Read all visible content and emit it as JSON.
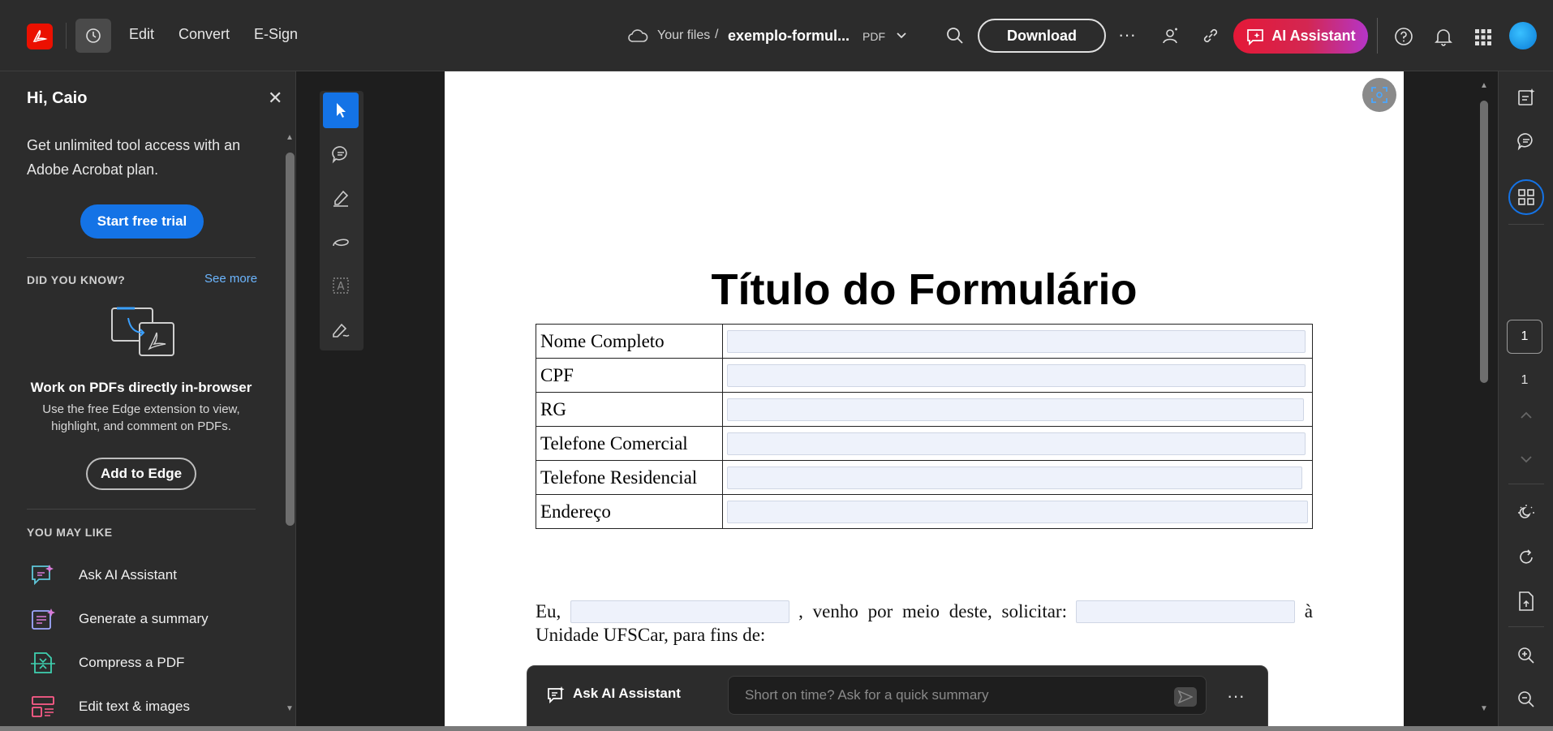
{
  "topbar": {
    "menus": [
      "Edit",
      "Convert",
      "E-Sign"
    ],
    "breadcrumb_root": "Your files",
    "breadcrumb_sep": "/",
    "filename": "exemplo-formul...",
    "file_type": "PDF",
    "download_label": "Download",
    "ai_assistant_label": "AI Assistant"
  },
  "left_panel": {
    "greeting": "Hi, Caio",
    "promo_text": "Get unlimited tool access with an Adobe Acrobat plan.",
    "trial_button": "Start free trial",
    "did_you_know_heading": "DID YOU KNOW?",
    "see_more": "See more",
    "tip_title": "Work on PDFs directly in-browser",
    "tip_desc": "Use the free Edge extension to view, highlight, and comment on PDFs.",
    "edge_button": "Add to Edge",
    "you_may_like_heading": "YOU MAY LIKE",
    "suggestions": [
      {
        "label": "Ask AI Assistant",
        "icon": "ai-chat-icon"
      },
      {
        "label": "Generate a summary",
        "icon": "summary-icon"
      },
      {
        "label": "Compress a PDF",
        "icon": "compress-icon"
      },
      {
        "label": "Edit text & images",
        "icon": "edit-text-images-icon"
      }
    ]
  },
  "document": {
    "title": "Título do Formulário",
    "fields": [
      "Nome Completo",
      "CPF",
      "RG",
      "Telefone Comercial",
      "Telefone Residencial",
      "Endereço"
    ],
    "sentence_part1": "Eu,",
    "sentence_part2": ", venho por meio deste, solicitar:",
    "sentence_part3": "à",
    "sentence_part4": "Unidade UFSCar, para fins de:"
  },
  "ai_bar": {
    "label": "Ask AI Assistant",
    "placeholder": "Short on time? Ask for a quick summary"
  },
  "page_nav": {
    "current": "1",
    "total": "1"
  },
  "colors": {
    "accent_blue": "#1473e6",
    "brand_red": "#eb1000",
    "ai_gradient_start": "#e51837",
    "ai_gradient_end": "#b535c8"
  }
}
